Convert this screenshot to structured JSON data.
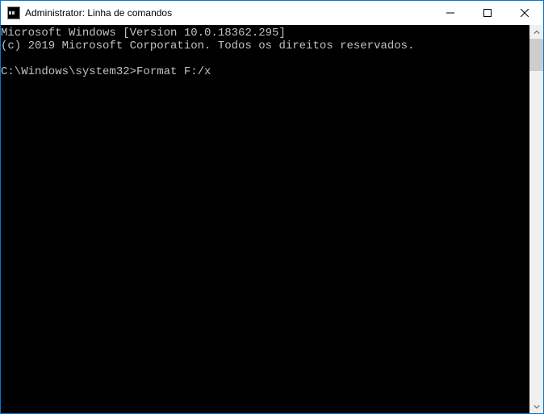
{
  "window": {
    "title": "Administrator: Linha de comandos"
  },
  "console": {
    "line1": "Microsoft Windows [Version 10.0.18362.295]",
    "line2": "(c) 2019 Microsoft Corporation. Todos os direitos reservados.",
    "blank": "",
    "prompt": "C:\\Windows\\system32>",
    "command": "Format F:/x"
  }
}
